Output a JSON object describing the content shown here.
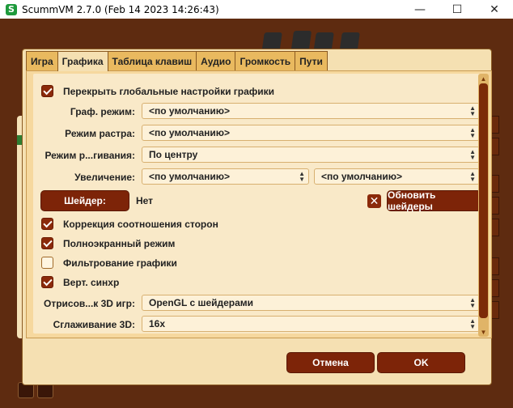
{
  "window": {
    "title": "ScummVM 2.7.0 (Feb 14 2023 14:26:43)",
    "app_icon": "S",
    "minimize": "—",
    "maximize": "☐",
    "close": "✕"
  },
  "tabs": [
    {
      "label": "Игра",
      "active": false
    },
    {
      "label": "Графика",
      "active": true
    },
    {
      "label": "Таблица клавиш",
      "active": false
    },
    {
      "label": "Аудио",
      "active": false
    },
    {
      "label": "Громкость",
      "active": false
    },
    {
      "label": "Пути",
      "active": false
    }
  ],
  "graphics": {
    "override_label": "Перекрыть глобальные настройки графики",
    "override_checked": true,
    "gfx_mode_label": "Граф. режим:",
    "gfx_mode_value": "<по умолчанию>",
    "render_mode_label": "Режим растра:",
    "render_mode_value": "<по умолчанию>",
    "stretch_mode_label": "Режим р...гивания:",
    "stretch_mode_value": "По центру",
    "scale_label": "Увеличение:",
    "scale_value": "<по умолчанию>",
    "scale_factor_value": "<по умолчанию>",
    "shader_button": "Шейдер:",
    "shader_value": "Нет",
    "update_shaders_button": "Обновить шейдеры",
    "aspect_label": "Коррекция соотношения сторон",
    "aspect_checked": true,
    "fullscreen_label": "Полноэкранный режим",
    "fullscreen_checked": true,
    "filter_label": "Фильтрование графики",
    "filter_checked": false,
    "vsync_label": "Верт. синхр",
    "vsync_checked": true,
    "renderer_label": "Отрисов...к 3D игр:",
    "renderer_value": "OpenGL с шейдерами",
    "antialias_label": "Сглаживание 3D:",
    "antialias_value": "16x"
  },
  "footer": {
    "cancel": "Отмена",
    "ok": "OK"
  },
  "colors": {
    "accent": "#7d2408",
    "background": "#5e2b10",
    "panel": "#f5e0b2",
    "tab": "#e9b95f"
  }
}
